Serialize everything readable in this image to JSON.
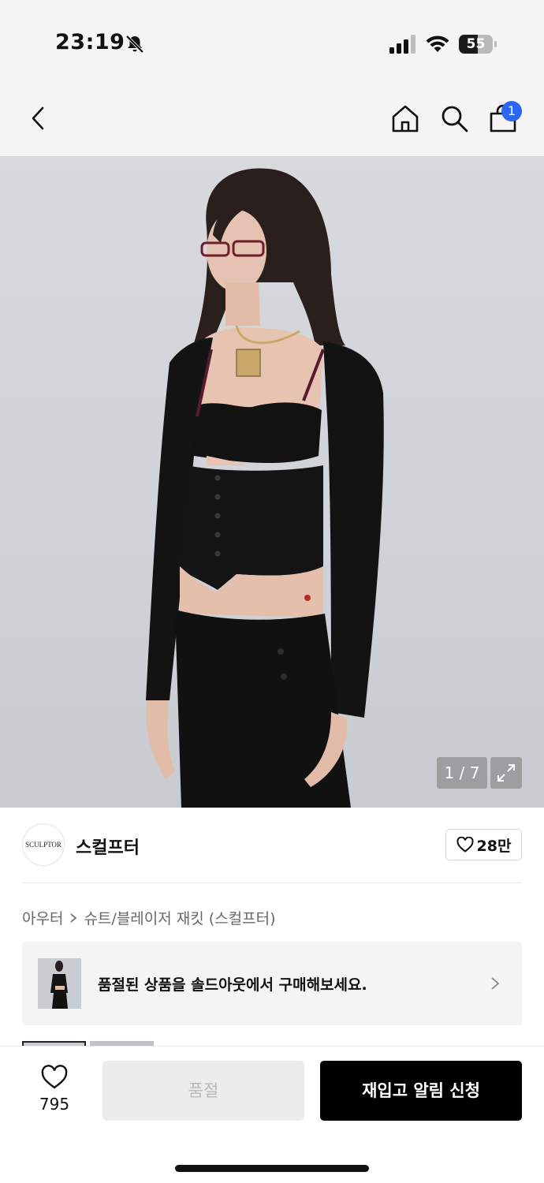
{
  "status_bar": {
    "time": "23:19",
    "battery_level": "55",
    "icons": [
      "bell-slash-icon",
      "cellular-signal-icon",
      "wifi-icon",
      "battery-icon"
    ]
  },
  "nav": {
    "icons": [
      "chevron-left-icon",
      "home-icon",
      "search-icon",
      "shopping-bag-icon"
    ],
    "cart_count": "1"
  },
  "product": {
    "image_alt": "",
    "image_counter": "1 / 7",
    "expand_icon": "expand-icon"
  },
  "brand": {
    "logo_text": "SCULPTOR",
    "name": "스컬프터",
    "likes": "28만"
  },
  "breadcrumb": {
    "category": "아우터",
    "subcategory": "슈트/블레이저 재킷 (스컬프터)"
  },
  "soldout_banner": {
    "text": "품절된 상품을 솔드아웃에서 구매해보세요."
  },
  "bottom_bar": {
    "wish_count": "795",
    "soldout_label": "품절",
    "restock_label": "재입고 알림 신청"
  },
  "colors": {
    "badge_blue": "#2b66f5",
    "primary_button": "#000000",
    "disabled_button": "#ececec"
  }
}
